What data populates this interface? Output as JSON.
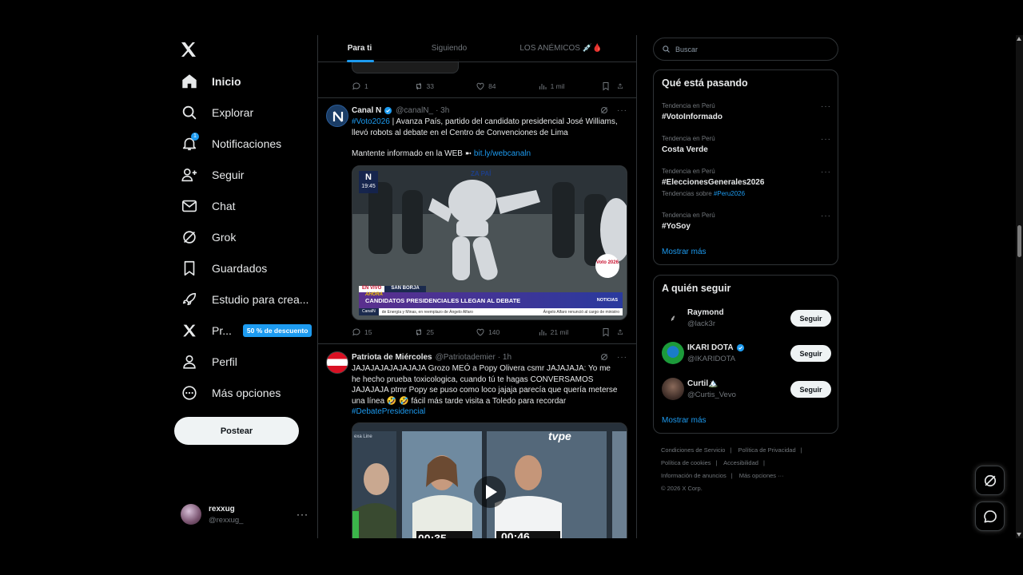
{
  "nav": {
    "items": [
      {
        "label": "Inicio",
        "icon": "home-icon"
      },
      {
        "label": "Explorar",
        "icon": "search-icon"
      },
      {
        "label": "Notificaciones",
        "icon": "bell-icon",
        "badge": "1"
      },
      {
        "label": "Seguir",
        "icon": "person-add-icon"
      },
      {
        "label": "Chat",
        "icon": "mail-icon"
      },
      {
        "label": "Grok",
        "icon": "grok-icon"
      },
      {
        "label": "Guardados",
        "icon": "bookmark-icon"
      },
      {
        "label": "Estudio para crea...",
        "icon": "rocket-icon"
      },
      {
        "label": "Pr...",
        "icon": "x-premium-icon",
        "promo": "50 % de descuento"
      },
      {
        "label": "Perfil",
        "icon": "person-icon"
      },
      {
        "label": "Más opciones",
        "icon": "more-circle-icon"
      }
    ],
    "post_label": "Postear"
  },
  "account": {
    "name": "rexxug",
    "handle": "@rexxug_"
  },
  "tabs": [
    "Para ti",
    "Siguiendo",
    "LOS ANÉMICOS 💉🩸"
  ],
  "top_tweet_actions": {
    "replies": "1",
    "reposts": "33",
    "likes": "84",
    "views": "1 mil"
  },
  "tweet1": {
    "name": "Canal N",
    "handle": "@canalN_",
    "time": "· 3h",
    "hashtag": "#Voto2026",
    "text": " | Avanza País, partido del candidato presidencial José Williams, llevó robots al debate en el Centro de Convenciones de Lima",
    "text2": "Mantente informado en la WEB ➼ ",
    "link": "bit.ly/webcanaln",
    "video": {
      "logo_time": "19:45",
      "brand": "ZA PAÍ",
      "live": "EN VIVO",
      "place": "SAN BORJA",
      "kicker": "AHORA",
      "headline": "CANDIDATOS PRESIDENCIALES LLEGAN AL DEBATE",
      "ticker_left": "CanalN",
      "ticker_mid": "de Energía y Minas, en reemplazo de Ángelo Alfaro",
      "ticker_right": "Ángelo Alfaro renunció al cargo de ministro",
      "channel": "NOTICIAS",
      "voto_badge": "Voto 2026"
    },
    "actions": {
      "replies": "15",
      "reposts": "25",
      "likes": "140",
      "views": "21 mil"
    }
  },
  "tweet2": {
    "name": "Patriota de Miércoles",
    "handle": "@Patriotademier",
    "time": "· 1h",
    "text": "JAJAJAJAJAJAJAJA Grozo MEÓ a Popy Olivera csmr JAJAJAJA: Yo me he hecho prueba toxicologica, cuando tú te hagas CONVERSAMOS JAJAJAJA ptmr Popy se puso como loco jajaja parecía que quería meterse una línea 🤣",
    "text_b": "🤣 fácil más tarde visita a Toledo para recordar",
    "hashtag": "#DebatePresidencial",
    "video": {
      "channel_logo": "tvpe",
      "left_tag": "exa Line",
      "clock1": "00:35",
      "clock2": "00:46"
    }
  },
  "search": {
    "placeholder": "Buscar"
  },
  "trends": {
    "title": "Qué está pasando",
    "items": [
      {
        "meta": "Tendencia en Perú",
        "name": "#VotoInformado"
      },
      {
        "meta": "Tendencia en Perú",
        "name": "Costa Verde"
      },
      {
        "meta": "Tendencia en Perú",
        "name": "#EleccionesGenerales2026",
        "sub_prefix": "Tendencias sobre ",
        "sub_link": "#Peru2026"
      },
      {
        "meta": "Tendencia en Perú",
        "name": "#YoSoy"
      }
    ],
    "show_more": "Mostrar más"
  },
  "who_to_follow": {
    "title": "A quién seguir",
    "items": [
      {
        "name": "Raymond",
        "handle": "@lack3r",
        "button": "Seguir"
      },
      {
        "name": "IKARI DOTA",
        "handle": "@IKARIDOTA",
        "button": "Seguir",
        "verified": true
      },
      {
        "name": "Curtil🏔️",
        "handle": "@Curtis_Vevo",
        "button": "Seguir"
      }
    ],
    "show_more": "Mostrar más"
  },
  "footer": {
    "links": [
      "Condiciones de Servicio",
      "|",
      "Política de Privacidad",
      "|",
      "Política de cookies",
      "|",
      "Accesibilidad",
      "|",
      "Información de anuncios",
      "|",
      "Más opciones ···"
    ],
    "copyright": "© 2026 X Corp."
  },
  "colors": {
    "accent": "#1d9bf0",
    "background": "#000000",
    "border": "#2f3336",
    "muted": "#71767b",
    "text": "#e7e9ea"
  }
}
